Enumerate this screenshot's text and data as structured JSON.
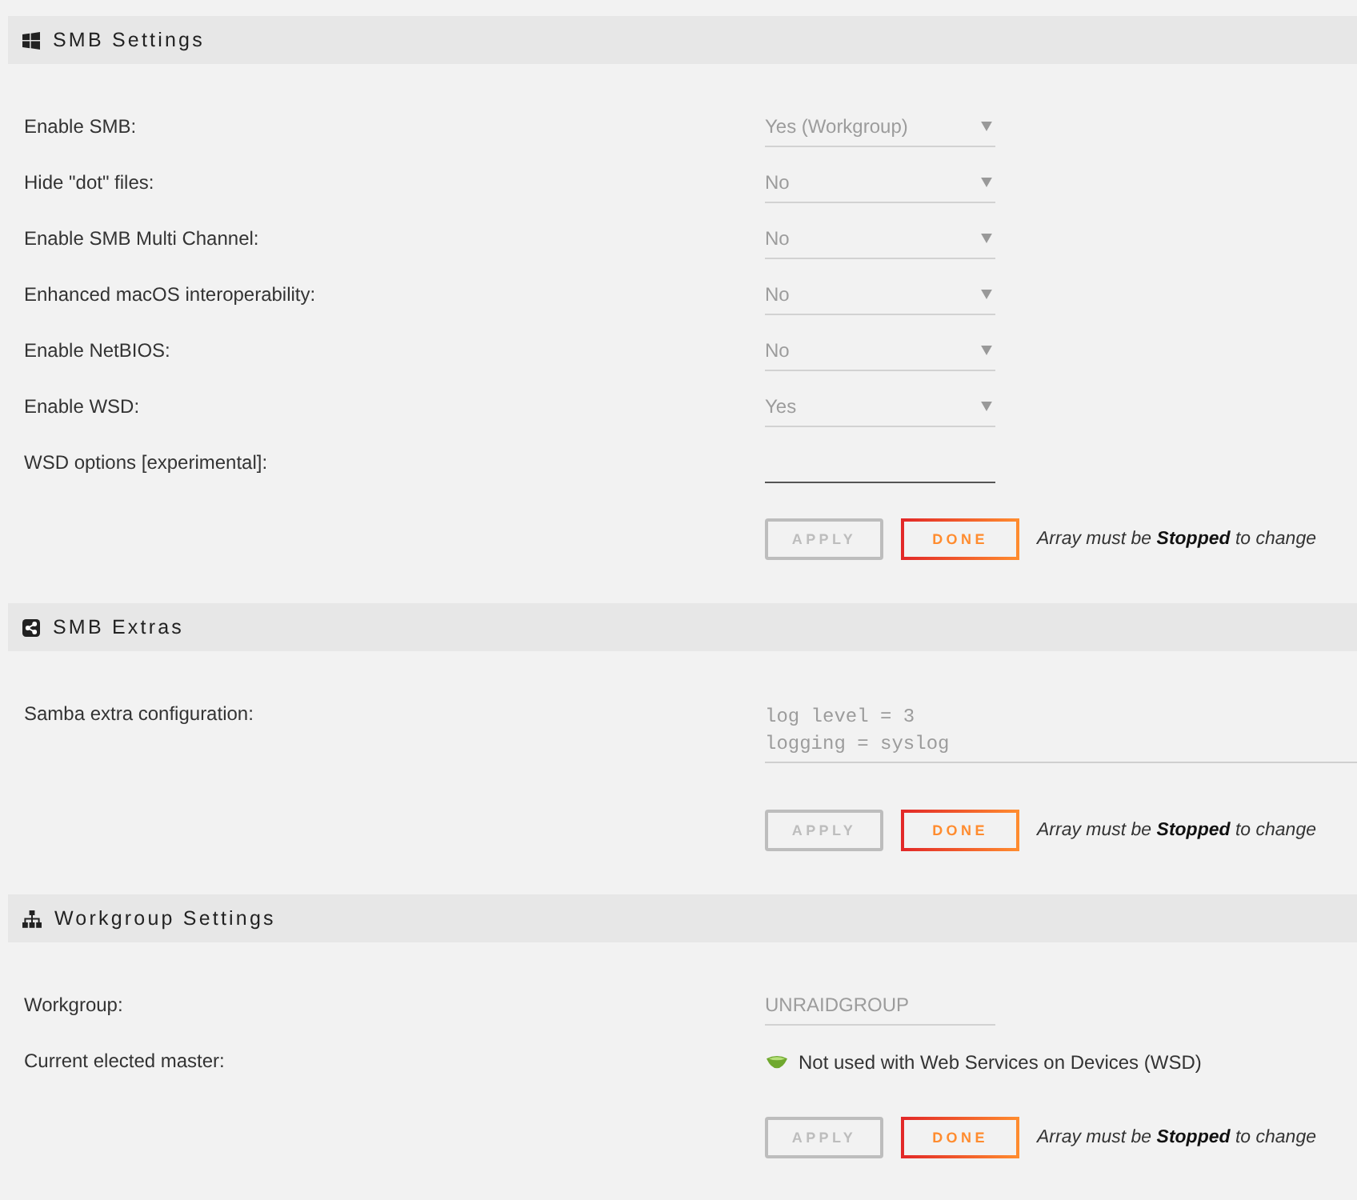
{
  "sections": [
    {
      "title": "SMB Settings",
      "rows": [
        {
          "kind": "select",
          "label": "Enable SMB:",
          "value": "Yes (Workgroup)",
          "disabled": true
        },
        {
          "kind": "select",
          "label": "Hide \"dot\" files:",
          "value": "No",
          "disabled": true
        },
        {
          "kind": "select",
          "label": "Enable SMB Multi Channel:",
          "value": "No",
          "disabled": true
        },
        {
          "kind": "select",
          "label": "Enhanced macOS interoperability:",
          "value": "No",
          "disabled": true
        },
        {
          "kind": "select",
          "label": "Enable NetBIOS:",
          "value": "No",
          "disabled": true
        },
        {
          "kind": "select",
          "label": "Enable WSD:",
          "value": "Yes",
          "disabled": true
        },
        {
          "kind": "input",
          "label": "WSD options [experimental]:",
          "disabled": false
        }
      ],
      "buttons": [
        {
          "label": "APPLY",
          "disabled": true
        },
        {
          "label": "DONE",
          "disabled": false
        }
      ],
      "note": "Array must be **Stopped** to change"
    },
    {
      "title": "SMB Extras",
      "rows": [
        {
          "kind": "textarea",
          "label": "Samba extra configuration:",
          "value": "log level = 3\nlogging = syslog",
          "disabled": true
        }
      ],
      "buttons": [
        {
          "label": "APPLY",
          "disabled": true
        },
        {
          "label": "DONE",
          "disabled": false
        }
      ],
      "note": "Array must be **Stopped** to change"
    },
    {
      "title": "Workgroup Settings",
      "rows": [
        {
          "kind": "input",
          "label": "Workgroup:",
          "value": "UNRAIDGROUP",
          "disabled": true
        },
        {
          "kind": "status",
          "label": "Current elected master:",
          "value": "Not used with Web Services on Devices (WSD)"
        }
      ],
      "buttons": [
        {
          "label": "APPLY",
          "disabled": true
        },
        {
          "label": "DONE",
          "disabled": false
        }
      ],
      "note": "Array must be **Stopped** to change"
    }
  ]
}
